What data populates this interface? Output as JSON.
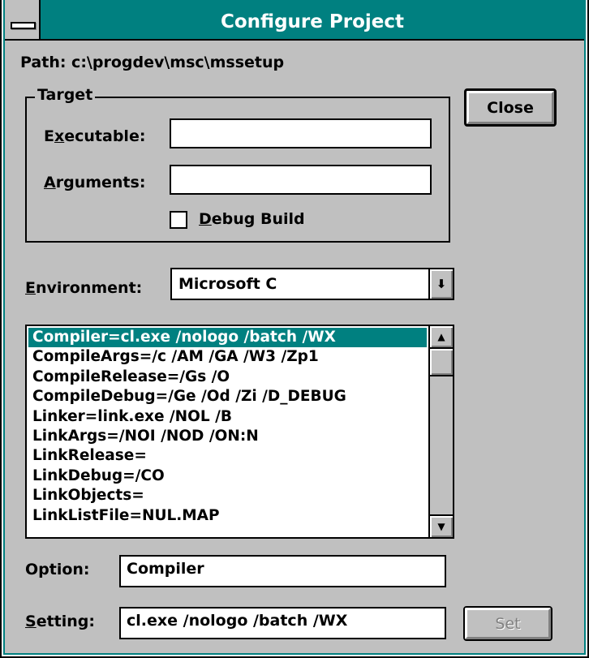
{
  "window": {
    "title": "Configure Project",
    "accent_color": "#008080",
    "face_color": "#c0c0c0"
  },
  "path_label": "Path: c:\\progdev\\msc\\mssetup",
  "target": {
    "group_title": "Target",
    "executable": {
      "label_pre": "E",
      "label_ul": "x",
      "label_post": "ecutable:",
      "value": ""
    },
    "arguments": {
      "label_ul": "A",
      "label_post": "rguments:",
      "value": ""
    },
    "debug_build": {
      "label_ul": "D",
      "label_post": "ebug Build",
      "checked": false
    }
  },
  "buttons": {
    "close": "Close",
    "set": "Set"
  },
  "environment": {
    "label_ul": "E",
    "label_post": "nvironment:",
    "value": "Microsoft C"
  },
  "options_list": {
    "selected_index": 0,
    "items": [
      "Compiler=cl.exe /nologo /batch /WX",
      "CompileArgs=/c /AM /GA /W3 /Zp1",
      "CompileRelease=/Gs /O",
      "CompileDebug=/Ge /Od /Zi /D_DEBUG",
      "Linker=link.exe /NOL /B",
      "LinkArgs=/NOI /NOD /ON:N",
      "LinkRelease=",
      "LinkDebug=/CO",
      "LinkObjects=",
      "LinkListFile=NUL.MAP"
    ]
  },
  "option": {
    "label": "Option:",
    "value": "Compiler"
  },
  "setting": {
    "label_ul": "S",
    "label_post": "etting:",
    "value": "cl.exe /nologo /batch /WX"
  }
}
